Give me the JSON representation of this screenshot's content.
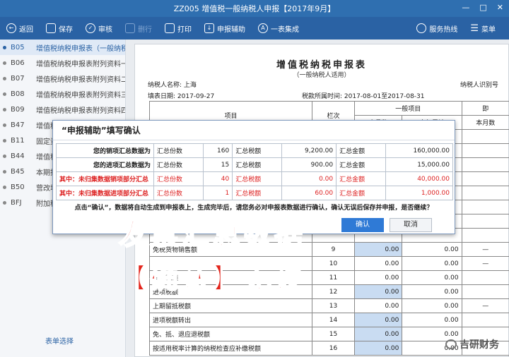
{
  "window": {
    "title": "ZZ005  增值税一般纳税人申报【2017年9月】"
  },
  "toolbar": [
    {
      "label": "返回",
      "icon": "back-icon",
      "enabled": true
    },
    {
      "label": "保存",
      "icon": "save-icon",
      "enabled": true
    },
    {
      "label": "审核",
      "icon": "check-icon",
      "enabled": true
    },
    {
      "label": "删行",
      "icon": "delete-row-icon",
      "enabled": false
    },
    {
      "label": "打印",
      "icon": "print-icon",
      "enabled": true
    },
    {
      "label": "申报辅助",
      "icon": "assist-icon",
      "enabled": true
    },
    {
      "label": "一表集成",
      "icon": "integrate-icon",
      "enabled": true
    }
  ],
  "toolbar_right": [
    {
      "label": "服务热线",
      "icon": "headset-icon"
    },
    {
      "label": "菜单",
      "icon": "menu-icon"
    }
  ],
  "sidebar": {
    "items": [
      {
        "code": "B05",
        "label": "增值税纳税申报表（一般纳税",
        "active": true
      },
      {
        "code": "B06",
        "label": "增值税纳税申报表附列资料一",
        "active": false
      },
      {
        "code": "B07",
        "label": "增值税纳税申报表附列资料二",
        "active": false
      },
      {
        "code": "B08",
        "label": "增值税纳税申报表附列资料三",
        "active": false
      },
      {
        "code": "B09",
        "label": "增值税纳税申报表附列资料四",
        "active": false
      },
      {
        "code": "B47",
        "label": "增值税",
        "active": false
      },
      {
        "code": "B11",
        "label": "固定资",
        "active": false
      },
      {
        "code": "B44",
        "label": "增值税",
        "active": false
      },
      {
        "code": "B45",
        "label": "本期抵",
        "active": false
      },
      {
        "code": "B50",
        "label": "营改增",
        "active": false
      },
      {
        "code": "BFJ",
        "label": "附加税",
        "active": false
      }
    ],
    "footer": "表单选择"
  },
  "form": {
    "title": "增值税纳税申报表",
    "subtitle": "（一般纳税人适用）",
    "taxpayer_label": "纳税人名称: 上海",
    "taxpayer_id_label": "纳税人识别号",
    "fill_date": "填表日期: 2017-09-27",
    "period": "税款所属时间: 2017-08-01至2017-08-31",
    "col_item": "项目",
    "col_row": "栏次",
    "col_general": "一般项目",
    "col_month": "本月数",
    "col_year": "本年累计",
    "col_month2": "本月数",
    "col_immediate": "即",
    "rows": [
      {
        "item": "免税货物销售额",
        "row": "9",
        "month": "0.00",
        "year": "0.00"
      },
      {
        "item": "销项税额",
        "row": "11",
        "month": "0.00",
        "year": "0.00"
      },
      {
        "item": "进项税额",
        "row": "12",
        "month": "0.00",
        "year": "0.00"
      },
      {
        "item": "上期留抵税额",
        "row": "13",
        "month": "0.00",
        "year": "0.00"
      },
      {
        "item": "进项税额转出",
        "row": "14",
        "month": "0.00",
        "year": "0.00"
      },
      {
        "item": "免、抵、退应退税额",
        "row": "15",
        "month": "0.00",
        "year": "0.00"
      },
      {
        "item": "按适用税率计算的纳税检查应补缴税额",
        "row": "16",
        "month": "0.00",
        "year": "0.00"
      }
    ]
  },
  "dialog": {
    "title": "“申报辅助”填写确认",
    "rows": [
      {
        "label": "您的销项汇总数据为",
        "count_label": "汇总份数",
        "count": "160",
        "tax_label": "汇总税额",
        "tax": "9,200.00",
        "amt_label": "汇总金额",
        "amt": "160,000.00",
        "red": false
      },
      {
        "label": "您的进项汇总数据为",
        "count_label": "汇总份数",
        "count": "15",
        "tax_label": "汇总税额",
        "tax": "900.00",
        "amt_label": "汇总金额",
        "amt": "15,000.00",
        "red": false
      },
      {
        "label": "其中：未归集数据销项部分汇总",
        "count_label": "汇总份数",
        "count": "40",
        "tax_label": "汇总税额",
        "tax": "0.00",
        "amt_label": "汇总金额",
        "amt": "40,000.00",
        "red": true
      },
      {
        "label": "其中：未归集数据进项部分汇总",
        "count_label": "汇总份数",
        "count": "1",
        "tax_label": "汇总税额",
        "tax": "60.00",
        "amt_label": "汇总金额",
        "amt": "1,000.00",
        "red": true
      }
    ],
    "message": "点击“确认”，数据将自动生成到申报表上，生成完毕后，请您务必对申报表数据进行确认，确认无误后保存并申报，是否继续？",
    "ok_label": "确认",
    "cancel_label": "取消"
  },
  "overlay": {
    "line1": "发票汇总数据",
    "line2": "【确认】无误"
  },
  "watermark": {
    "text": "吉研财务"
  }
}
